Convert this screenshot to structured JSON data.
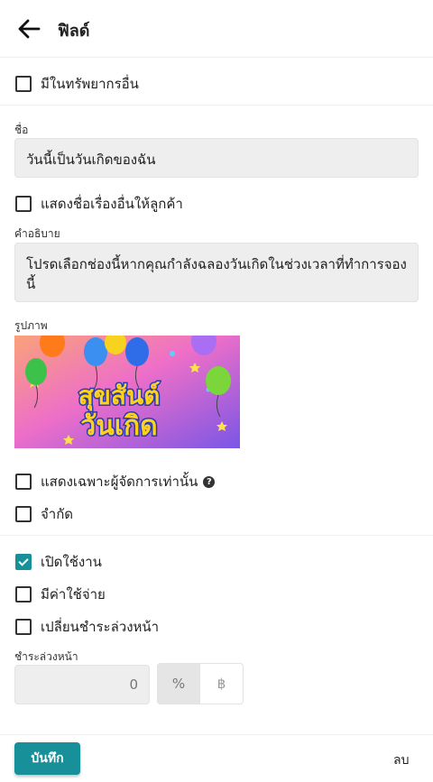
{
  "header": {
    "title": "ฟิลด์"
  },
  "options": {
    "other_resources": "มีในทรัพยากรอื่น",
    "show_other_title": "แสดงชื่อเรื่องอื่นให้ลูกค้า",
    "admin_only": "แสดงเฉพาะผู้จัดการเท่านั้น",
    "limited": "จำกัด",
    "enabled": "เปิดใช้งาน",
    "has_cost": "มีค่าใช้จ่าย",
    "change_deposit": "เปลี่ยนชำระล่วงหน้า"
  },
  "states": {
    "enabled": true
  },
  "name": {
    "label": "ชื่อ",
    "value": "วันนี้เป็นวันเกิดของฉัน"
  },
  "description": {
    "label": "คำอธิบาย",
    "value": "โปรดเลือกช่องนี้หากคุณกำลังฉลองวันเกิดในช่วงเวลาที่ทำการจองนี้"
  },
  "image": {
    "label": "รูปภาพ",
    "text_line1": "สุขสันต์",
    "text_line2": "วันเกิด"
  },
  "deposit": {
    "label": "ชำระล่วงหน้า",
    "value": "0",
    "unit_percent": "%",
    "unit_baht": "฿"
  },
  "footer": {
    "save_label": "บันทึก",
    "delete_label": "ลบ"
  },
  "colors": {
    "accent": "#17909a"
  }
}
